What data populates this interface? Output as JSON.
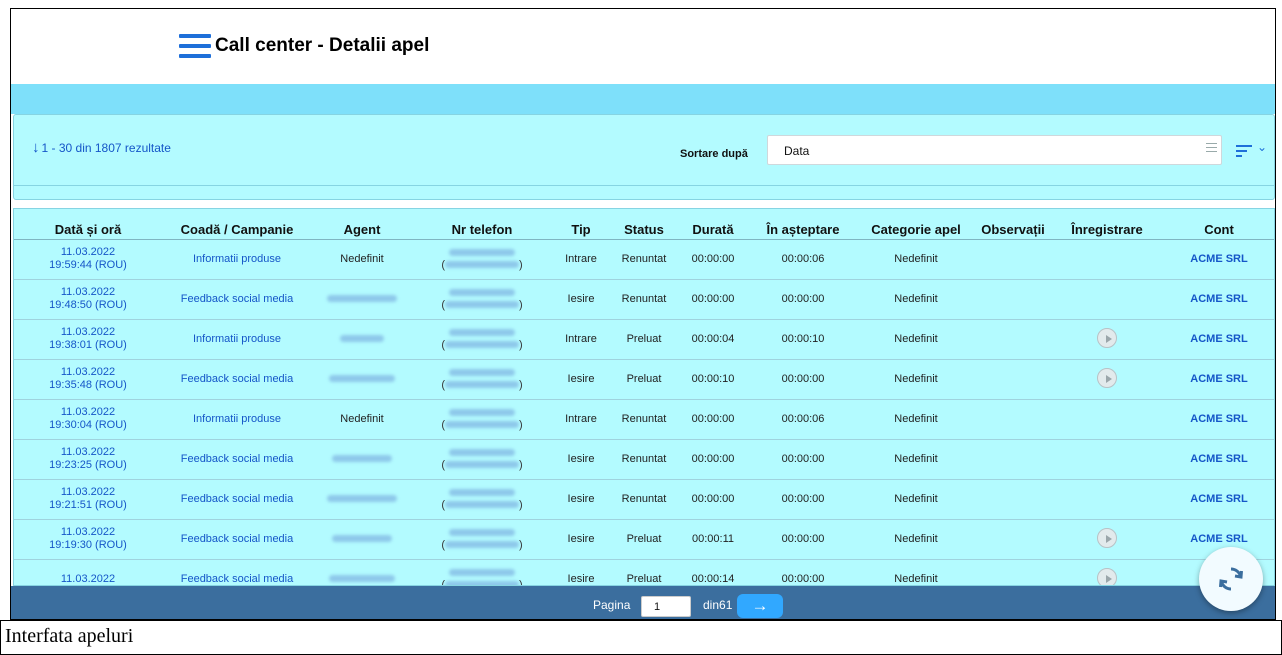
{
  "app": {
    "title": "Call center - Detalii apel"
  },
  "results_text": "1 - 30 din 1807 rezultate",
  "sort": {
    "label": "Sortare după",
    "value": "Data"
  },
  "table": {
    "headers": [
      "Dată și oră",
      "Coadă / Campanie",
      "Agent",
      "Nr telefon",
      "Tip",
      "Status",
      "Durată",
      "În așteptare",
      "Categorie apel",
      "Observații",
      "Înregistrare",
      "Cont"
    ],
    "rows": [
      {
        "date": "11.03.2022",
        "time": "19:59:44 (ROU)",
        "queue": "Informatii produse",
        "agent": "Nedefinit",
        "tip": "Intrare",
        "status": "Renuntat",
        "durata": "00:00:00",
        "asteptare": "00:00:06",
        "categorie": "Nedefinit",
        "observatii": "",
        "recording": false,
        "cont": "ACME SRL"
      },
      {
        "date": "11.03.2022",
        "time": "19:48:50 (ROU)",
        "queue": "Feedback social media",
        "agent": "",
        "tip": "Iesire",
        "status": "Renuntat",
        "durata": "00:00:00",
        "asteptare": "00:00:00",
        "categorie": "Nedefinit",
        "observatii": "",
        "recording": false,
        "cont": "ACME SRL"
      },
      {
        "date": "11.03.2022",
        "time": "19:38:01 (ROU)",
        "queue": "Informatii produse",
        "agent": "",
        "tip": "Intrare",
        "status": "Preluat",
        "durata": "00:00:04",
        "asteptare": "00:00:10",
        "categorie": "Nedefinit",
        "observatii": "",
        "recording": true,
        "cont": "ACME SRL"
      },
      {
        "date": "11.03.2022",
        "time": "19:35:48 (ROU)",
        "queue": "Feedback social media",
        "agent": "",
        "tip": "Iesire",
        "status": "Preluat",
        "durata": "00:00:10",
        "asteptare": "00:00:00",
        "categorie": "Nedefinit",
        "observatii": "",
        "recording": true,
        "cont": "ACME SRL"
      },
      {
        "date": "11.03.2022",
        "time": "19:30:04 (ROU)",
        "queue": "Informatii produse",
        "agent": "Nedefinit",
        "tip": "Intrare",
        "status": "Renuntat",
        "durata": "00:00:00",
        "asteptare": "00:00:06",
        "categorie": "Nedefinit",
        "observatii": "",
        "recording": false,
        "cont": "ACME SRL"
      },
      {
        "date": "11.03.2022",
        "time": "19:23:25 (ROU)",
        "queue": "Feedback social media",
        "agent": "",
        "tip": "Iesire",
        "status": "Renuntat",
        "durata": "00:00:00",
        "asteptare": "00:00:00",
        "categorie": "Nedefinit",
        "observatii": "",
        "recording": false,
        "cont": "ACME SRL"
      },
      {
        "date": "11.03.2022",
        "time": "19:21:51 (ROU)",
        "queue": "Feedback social media",
        "agent": "",
        "tip": "Iesire",
        "status": "Renuntat",
        "durata": "00:00:00",
        "asteptare": "00:00:00",
        "categorie": "Nedefinit",
        "observatii": "",
        "recording": false,
        "cont": "ACME SRL"
      },
      {
        "date": "11.03.2022",
        "time": "19:19:30 (ROU)",
        "queue": "Feedback social media",
        "agent": "",
        "tip": "Iesire",
        "status": "Preluat",
        "durata": "00:00:11",
        "asteptare": "00:00:00",
        "categorie": "Nedefinit",
        "observatii": "",
        "recording": true,
        "cont": "ACME SRL"
      },
      {
        "date": "11.03.2022",
        "time": "",
        "queue": "Feedback social media",
        "agent": "",
        "tip": "Iesire",
        "status": "Preluat",
        "durata": "00:00:14",
        "asteptare": "00:00:00",
        "categorie": "Nedefinit",
        "observatii": "",
        "recording": true,
        "cont": ""
      }
    ]
  },
  "pager": {
    "label": "Pagina",
    "page": "1",
    "of": "din61"
  },
  "caption": "Interfata apeluri",
  "colors": {
    "accent": "#1e6fd9",
    "link": "#1556c8",
    "panel": "#b3fbff",
    "strip": "#7ee0fa",
    "pager": "#3b6e9e",
    "next_button": "#31a8ff"
  },
  "icons": {
    "menu": "hamburger-icon",
    "results": "arrow-down-icon",
    "sort": "sort-direction-icon",
    "refresh": "refresh-icon",
    "next": "arrow-right-icon",
    "play": "play-icon"
  }
}
